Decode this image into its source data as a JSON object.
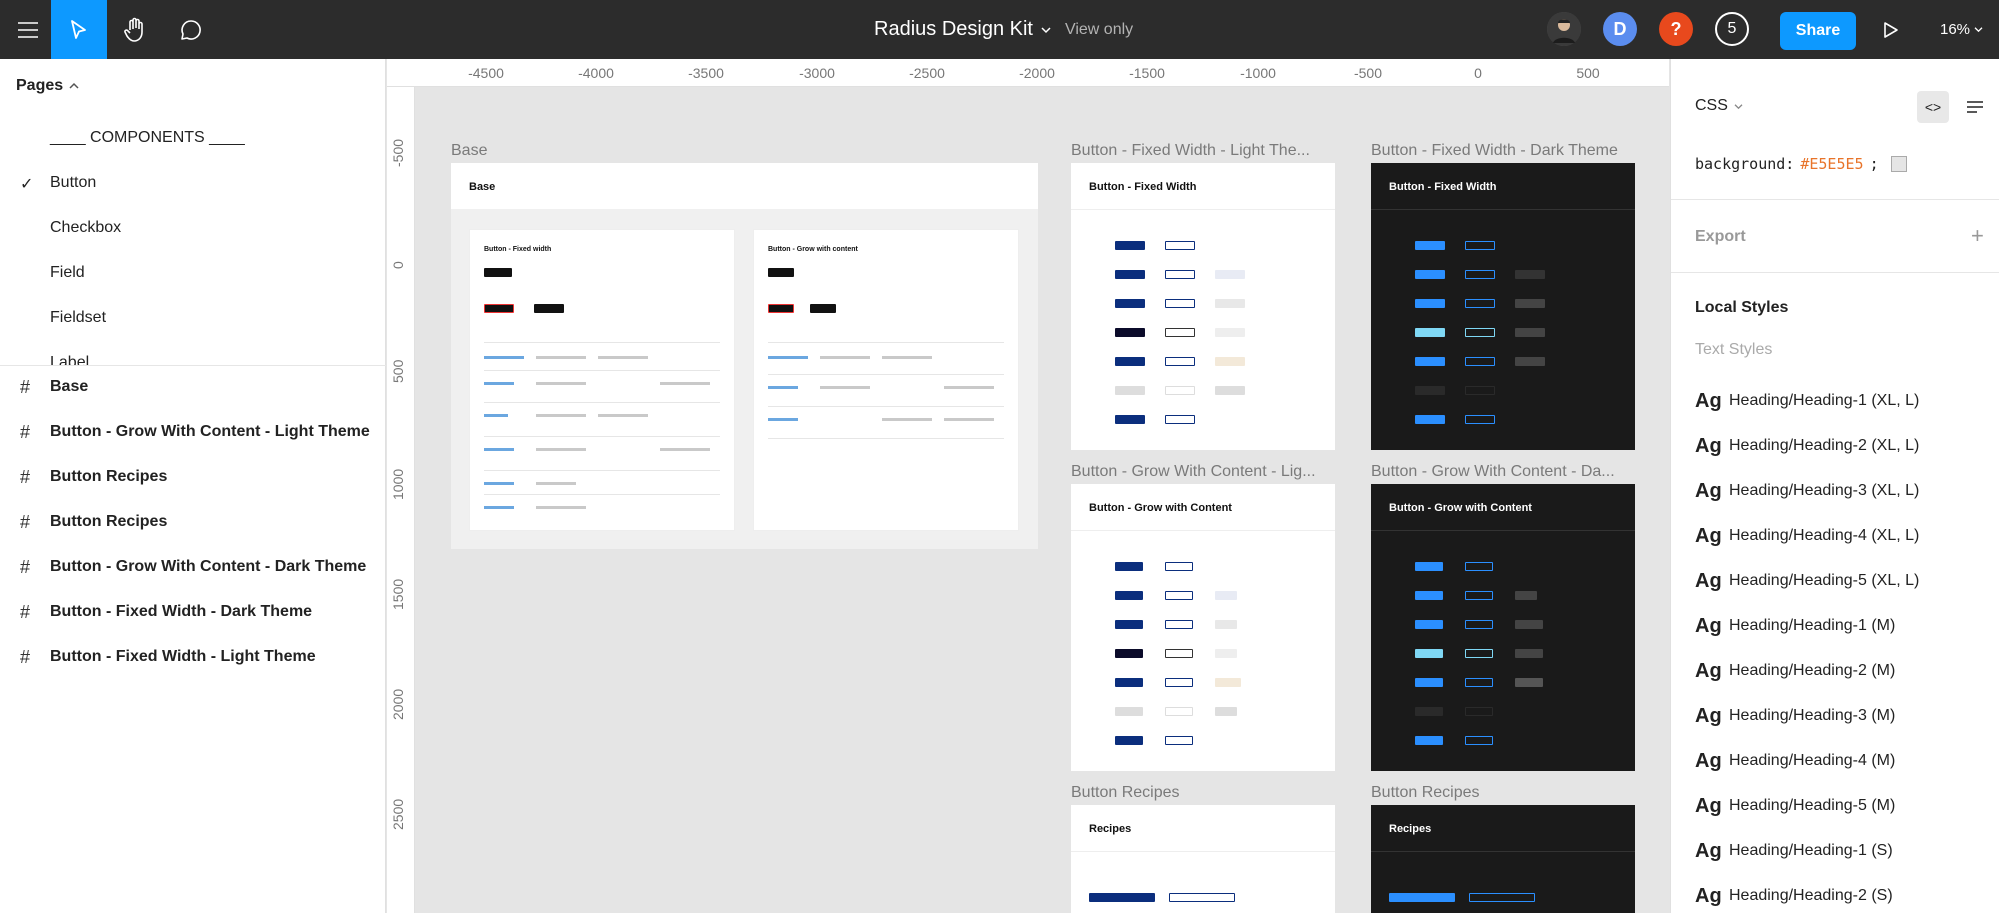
{
  "topbar": {
    "title": "Radius Design Kit",
    "view_mode": "View only",
    "avatar_d": "D",
    "avatar_q": "?",
    "viewer_count": "5",
    "share_label": "Share",
    "zoom": "16%",
    "colors": {
      "bg": "#2c2c2c",
      "accent": "#0d99ff",
      "avatar_d": "#5b8def",
      "avatar_q": "#e8491d"
    }
  },
  "pages": {
    "header": "Pages",
    "items": [
      {
        "label": "____ COMPONENTS ____"
      },
      {
        "label": "Button",
        "selected": true
      },
      {
        "label": "Checkbox"
      },
      {
        "label": "Field"
      },
      {
        "label": "Fieldset"
      },
      {
        "label": "Label"
      }
    ]
  },
  "layers": [
    "Base",
    "Button - Grow With Content - Light Theme",
    "Button Recipes",
    "Button Recipes",
    "Button - Grow With Content - Dark Theme",
    "Button - Fixed Width - Dark Theme",
    "Button - Fixed Width - Light Theme"
  ],
  "ruler": {
    "x_ticks": [
      "-4500",
      "-4000",
      "-3500",
      "-3000",
      "-2500",
      "-2000",
      "-1500",
      "-1000",
      "-500",
      "0",
      "500"
    ],
    "y_ticks": [
      "-500",
      "0",
      "500",
      "1000",
      "1500",
      "2000",
      "2500"
    ]
  },
  "canvas": {
    "base": {
      "label": "Base",
      "title": "Base",
      "card1_title": "Button - Fixed width",
      "card2_title": "Button - Grow with content"
    },
    "fixed_light": {
      "label": "Button - Fixed Width - Light The...",
      "title": "Button - Fixed Width"
    },
    "fixed_dark": {
      "label": "Button - Fixed Width - Dark Theme",
      "title": "Button - Fixed Width"
    },
    "grow_light": {
      "label": "Button - Grow With Content - Lig...",
      "title": "Button - Grow with Content"
    },
    "grow_dark": {
      "label": "Button - Grow With Content - Da...",
      "title": "Button - Grow with Content"
    },
    "recipes_light": {
      "label": "Button Recipes",
      "title": "Recipes"
    },
    "recipes_dark": {
      "label": "Button Recipes",
      "title": "Recipes"
    }
  },
  "inspector": {
    "mode": "CSS",
    "code_property": "background:",
    "code_value": "#E5E5E5",
    "code_end": ";",
    "export_label": "Export",
    "local_styles": "Local Styles",
    "text_styles": "Text Styles",
    "ag": "Ag",
    "styles": [
      "Heading/Heading-1 (XL, L)",
      "Heading/Heading-2 (XL, L)",
      "Heading/Heading-3 (XL, L)",
      "Heading/Heading-4 (XL, L)",
      "Heading/Heading-5 (XL, L)",
      "Heading/Heading-1 (M)",
      "Heading/Heading-2 (M)",
      "Heading/Heading-3 (M)",
      "Heading/Heading-4 (M)",
      "Heading/Heading-5 (M)",
      "Heading/Heading-1 (S)",
      "Heading/Heading-2 (S)"
    ]
  }
}
